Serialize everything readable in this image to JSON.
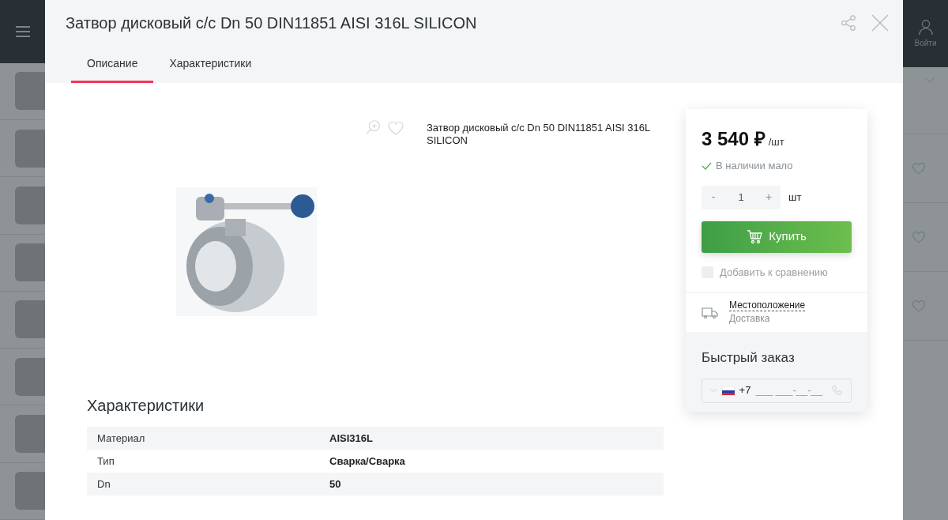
{
  "account": {
    "label": "Войти"
  },
  "modal": {
    "title": "Затвор дисковый с/с Dn 50 DIN11851 AISI 316L SILICON",
    "tabs": [
      {
        "label": "Описание",
        "selected": true
      },
      {
        "label": "Характеристики",
        "selected": false
      }
    ],
    "product_name": "Затвор дисковый с/с Dn 50 DIN11851 AISI 316L SILICON",
    "price": {
      "amount": "3 540 ₽",
      "unit": "/шт"
    },
    "stock": "В наличии мало",
    "quantity": {
      "minus": "-",
      "value": "1",
      "plus": "+",
      "unit": "шт"
    },
    "buy_button": "Купить",
    "compare": {
      "label": "Добавить к сравнению",
      "checked": false
    },
    "delivery": {
      "link": "Местоположение",
      "subtitle": "Доставка"
    },
    "quick_order": {
      "title": "Быстрый заказ",
      "code": "+7",
      "placeholder": "___ ___-__-__"
    },
    "characteristics": {
      "title": "Характеристики",
      "rows": [
        {
          "name": "Материал",
          "value": "AISI316L"
        },
        {
          "name": "Тип",
          "value": "Сварка/Сварка"
        },
        {
          "name": "Dn",
          "value": "50"
        }
      ]
    }
  }
}
